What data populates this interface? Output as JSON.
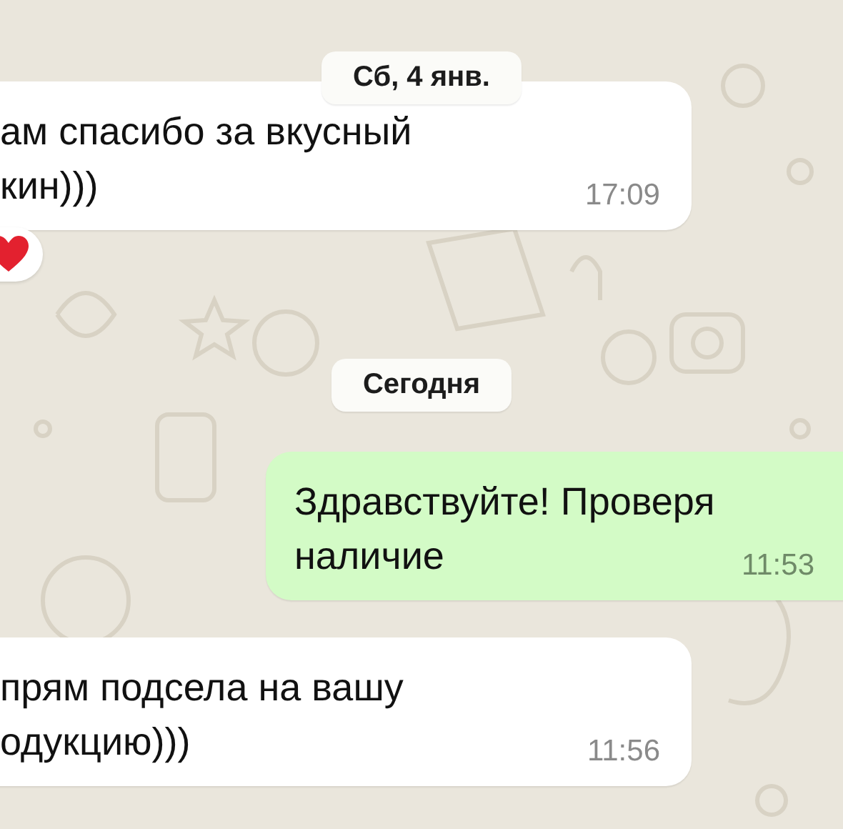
{
  "chat": [
    {
      "kind": "date",
      "label": "Сб, 4 янв."
    },
    {
      "kind": "incoming",
      "lines": [
        "ам спасибо за вкусный",
        "кин)))"
      ],
      "time": "17:09",
      "reaction": {
        "kind": "heart"
      }
    },
    {
      "kind": "date",
      "label": "Сегодня"
    },
    {
      "kind": "outgoing",
      "lines": [
        "Здравствуйте! Проверя",
        "наличие"
      ],
      "time": "11:53"
    },
    {
      "kind": "incoming",
      "lines": [
        "прям подсела на вашу",
        "одукцию)))"
      ],
      "time": "11:56"
    }
  ]
}
